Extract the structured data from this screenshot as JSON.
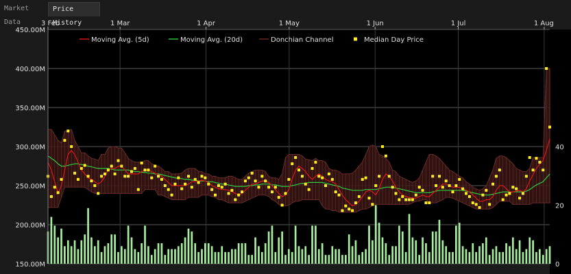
{
  "tabs": [
    {
      "label": "Market Data",
      "active": false
    },
    {
      "label": "Price History",
      "active": true
    }
  ],
  "colors": {
    "background": "#000000",
    "grid": "#5a5a5a",
    "moving_avg_5d": "#e01818",
    "moving_avg_20d": "#2ecc40",
    "donchian_fill": "#3a1414",
    "donchian_line": "#6a2a2a",
    "median_price": "#ffee22",
    "volume": "#a8f0a0"
  },
  "chart_data": {
    "type": "line",
    "x_ticks": [
      "3 Feb",
      "1 Mar",
      "1 Apr",
      "1 May",
      "1 Jun",
      "1 Jul",
      "1 Aug"
    ],
    "x_tick_days": [
      0,
      26,
      57,
      87,
      118,
      148,
      179
    ],
    "x_range_days": [
      0,
      181
    ],
    "y_ticks": [
      "450.00M",
      "400.00M",
      "350.00M",
      "300.00M",
      "250.00M",
      "200.00M",
      "150.00M"
    ],
    "y_tick_values": [
      450,
      400,
      350,
      300,
      250,
      200,
      150
    ],
    "ylim": [
      150,
      450
    ],
    "y2_ticks": [
      "40",
      "20",
      "0"
    ],
    "y2_tick_values": [
      40,
      20,
      0
    ],
    "y2lim": [
      0,
      80
    ],
    "legend": {
      "placement": "top",
      "entries": [
        {
          "label": "Moving Avg. (5d)",
          "kind": "line",
          "color": "#e01818"
        },
        {
          "label": "Moving Avg. (20d)",
          "kind": "line",
          "color": "#2ecc40"
        },
        {
          "label": "Donchian Channel",
          "kind": "band",
          "color": "#6a2a2a"
        },
        {
          "label": "Median Day Price",
          "kind": "square",
          "color": "#ffee22"
        }
      ]
    },
    "median_price": [
      262,
      236,
      248,
      241,
      258,
      308,
      320,
      300,
      266,
      258,
      272,
      276,
      262,
      256,
      250,
      240,
      262,
      265,
      270,
      275,
      265,
      282,
      275,
      262,
      262,
      268,
      272,
      245,
      279,
      270,
      270,
      260,
      275,
      262,
      258,
      250,
      245,
      238,
      252,
      260,
      246,
      252,
      262,
      248,
      258,
      254,
      262,
      260,
      252,
      245,
      238,
      250,
      248,
      252,
      240,
      244,
      232,
      238,
      242,
      256,
      260,
      266,
      256,
      248,
      262,
      256,
      248,
      242,
      248,
      235,
      225,
      240,
      258,
      278,
      286,
      270,
      262,
      252,
      245,
      272,
      280,
      262,
      260,
      250,
      265,
      258,
      242,
      238,
      218,
      224,
      220,
      218,
      228,
      236,
      258,
      260,
      234,
      226,
      250,
      262,
      300,
      288,
      262,
      248,
      240,
      232,
      236,
      232,
      232,
      232,
      238,
      248,
      244,
      228,
      228,
      262,
      250,
      262,
      248,
      256,
      250,
      242,
      250,
      258,
      246,
      240,
      236,
      228,
      226,
      222,
      238,
      244,
      226,
      252,
      262,
      270,
      232,
      238,
      240,
      248,
      246,
      234,
      240,
      262,
      286,
      270,
      285,
      280,
      270,
      400,
      325
    ],
    "donchian_upper": [
      322,
      322,
      315,
      308,
      305,
      320,
      320,
      322,
      308,
      300,
      292,
      292,
      288,
      285,
      284,
      282,
      290,
      290,
      298,
      300,
      300,
      298,
      298,
      292,
      285,
      282,
      280,
      280,
      280,
      282,
      282,
      278,
      276,
      275,
      272,
      268,
      268,
      265,
      265,
      265,
      266,
      270,
      272,
      272,
      272,
      268,
      268,
      265,
      265,
      262,
      262,
      260,
      260,
      260,
      262,
      262,
      260,
      258,
      258,
      262,
      266,
      268,
      270,
      270,
      270,
      268,
      262,
      260,
      260,
      258,
      265,
      286,
      290,
      290,
      290,
      290,
      288,
      284,
      283,
      282,
      285,
      282,
      282,
      280,
      272,
      270,
      270,
      268,
      265,
      265,
      265,
      266,
      270,
      275,
      280,
      290,
      300,
      302,
      300,
      290,
      288,
      285,
      280,
      270,
      268,
      262,
      260,
      258,
      256,
      254,
      256,
      260,
      270,
      280,
      290,
      290,
      288,
      285,
      280,
      275,
      270,
      268,
      265,
      262,
      260,
      255,
      252,
      248,
      246,
      244,
      246,
      250,
      260,
      270,
      285,
      288,
      288,
      286,
      282,
      278,
      272,
      270,
      268,
      268,
      272,
      286,
      286,
      286,
      286,
      400,
      400
    ],
    "donchian_lower": [
      222,
      222,
      222,
      222,
      235,
      248,
      248,
      248,
      248,
      248,
      248,
      248,
      245,
      242,
      240,
      240,
      240,
      240,
      240,
      240,
      240,
      240,
      240,
      240,
      240,
      240,
      240,
      240,
      240,
      245,
      245,
      245,
      245,
      238,
      238,
      236,
      234,
      232,
      232,
      232,
      232,
      232,
      235,
      235,
      235,
      235,
      238,
      238,
      238,
      236,
      235,
      232,
      232,
      230,
      228,
      228,
      228,
      228,
      228,
      230,
      232,
      234,
      236,
      238,
      238,
      238,
      236,
      232,
      230,
      226,
      224,
      224,
      225,
      228,
      230,
      230,
      232,
      232,
      232,
      232,
      232,
      232,
      224,
      220,
      220,
      218,
      218,
      216,
      216,
      216,
      216,
      216,
      216,
      218,
      220,
      220,
      222,
      224,
      226,
      226,
      226,
      226,
      226,
      226,
      226,
      226,
      226,
      226,
      226,
      228,
      230,
      230,
      232,
      232,
      228,
      228,
      228,
      230,
      232,
      235,
      235,
      234,
      232,
      230,
      228,
      226,
      224,
      222,
      220,
      220,
      220,
      220,
      220,
      222,
      226,
      230,
      230,
      230,
      230,
      226,
      226,
      226,
      226,
      226,
      226,
      228,
      228,
      228,
      228,
      228,
      228
    ],
    "moving_avg_5d": [
      280,
      270,
      255,
      240,
      250,
      270,
      290,
      295,
      290,
      280,
      270,
      265,
      260,
      258,
      255,
      252,
      255,
      262,
      270,
      272,
      272,
      275,
      275,
      270,
      265,
      265,
      265,
      265,
      268,
      270,
      270,
      268,
      266,
      264,
      262,
      258,
      254,
      250,
      250,
      250,
      250,
      250,
      252,
      255,
      255,
      256,
      257,
      256,
      254,
      250,
      248,
      246,
      245,
      245,
      244,
      242,
      240,
      238,
      240,
      244,
      248,
      252,
      252,
      254,
      256,
      256,
      254,
      250,
      245,
      240,
      236,
      238,
      245,
      258,
      270,
      275,
      272,
      268,
      262,
      258,
      262,
      265,
      262,
      258,
      256,
      255,
      252,
      245,
      238,
      232,
      228,
      224,
      226,
      230,
      236,
      242,
      244,
      242,
      238,
      246,
      258,
      265,
      262,
      256,
      248,
      242,
      238,
      236,
      235,
      234,
      234,
      236,
      238,
      236,
      236,
      240,
      244,
      248,
      252,
      252,
      250,
      248,
      248,
      248,
      246,
      244,
      242,
      238,
      234,
      230,
      230,
      232,
      232,
      236,
      244,
      250,
      250,
      246,
      242,
      242,
      243,
      244,
      242,
      246,
      256,
      264,
      272,
      278,
      282,
      295,
      310
    ],
    "moving_avg_20d": [
      288,
      285,
      282,
      278,
      275,
      275,
      276,
      277,
      278,
      278,
      277,
      276,
      275,
      274,
      273,
      272,
      272,
      272,
      272,
      271,
      270,
      270,
      270,
      270,
      270,
      269,
      268,
      268,
      267,
      267,
      266,
      266,
      265,
      265,
      264,
      263,
      262,
      261,
      260,
      259,
      259,
      258,
      258,
      257,
      257,
      256,
      256,
      256,
      255,
      255,
      254,
      253,
      252,
      252,
      251,
      250,
      249,
      249,
      249,
      249,
      250,
      250,
      251,
      251,
      252,
      252,
      252,
      251,
      251,
      250,
      249,
      249,
      249,
      250,
      251,
      252,
      253,
      253,
      254,
      254,
      254,
      254,
      254,
      253,
      252,
      251,
      250,
      249,
      247,
      246,
      245,
      244,
      244,
      244,
      244,
      245,
      245,
      245,
      245,
      246,
      247,
      248,
      248,
      248,
      247,
      246,
      245,
      244,
      243,
      242,
      241,
      241,
      241,
      241,
      241,
      242,
      243,
      244,
      244,
      244,
      244,
      244,
      244,
      244,
      244,
      243,
      242,
      241,
      240,
      239,
      238,
      238,
      238,
      239,
      240,
      241,
      242,
      242,
      242,
      242,
      242,
      242,
      242,
      243,
      245,
      248,
      251,
      253,
      255,
      260,
      265
    ],
    "volume": [
      11,
      16,
      13,
      9,
      12,
      6,
      8,
      6,
      8,
      5,
      8,
      10,
      19,
      9,
      6,
      8,
      4,
      6,
      7,
      10,
      10,
      4,
      6,
      5,
      13,
      9,
      5,
      4,
      7,
      13,
      6,
      3,
      5,
      7,
      7,
      3,
      5,
      5,
      5,
      6,
      7,
      9,
      12,
      11,
      7,
      4,
      5,
      7,
      7,
      6,
      4,
      4,
      6,
      4,
      4,
      5,
      5,
      7,
      7,
      7,
      3,
      3,
      9,
      6,
      4,
      7,
      11,
      13,
      4,
      9,
      11,
      3,
      5,
      4,
      13,
      6,
      5,
      6,
      3,
      13,
      13,
      5,
      7,
      3,
      3,
      6,
      5,
      5,
      3,
      3,
      10,
      6,
      8,
      3,
      4,
      5,
      13,
      8,
      20,
      14,
      9,
      7,
      3,
      6,
      6,
      13,
      11,
      4,
      17,
      9,
      8,
      3,
      9,
      7,
      4,
      11,
      11,
      15,
      8,
      6,
      4,
      4,
      13,
      14,
      6,
      5,
      4,
      7,
      4,
      6,
      7,
      9,
      3,
      5,
      6,
      4,
      4,
      7,
      6,
      9,
      5,
      8,
      4,
      5,
      9,
      8,
      4,
      5,
      3,
      5,
      6
    ]
  }
}
